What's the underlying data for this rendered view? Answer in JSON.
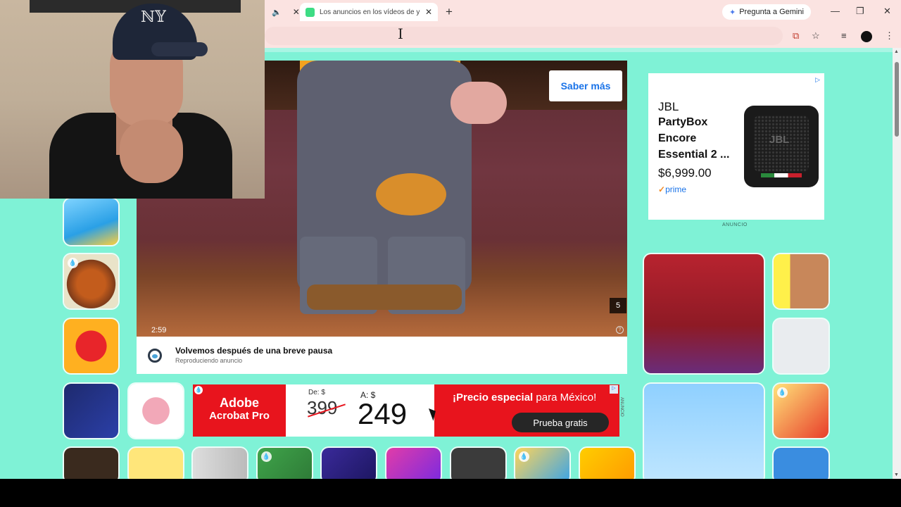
{
  "browser": {
    "tabs": [
      {
        "label": "Los anuncios en los vídeos de y",
        "active": true
      }
    ],
    "gemini_label": "Pregunta a Gemini",
    "new_tab_symbol": "+",
    "window_controls": {
      "minimize": "—",
      "maximize": "❐",
      "close": "✕"
    }
  },
  "video_ad": {
    "cta_label": "Saber más",
    "duration": "2:59",
    "skip_countdown": "5",
    "info_title": "Volvemos después de una breve pausa",
    "info_subtitle": "Reproduciendo anuncio"
  },
  "display_ad": {
    "brand": "JBL",
    "product": "PartyBox Encore Essential 2 ...",
    "price": "$6,999.00",
    "prime_label": "prime",
    "speaker_logo": "JBL",
    "ad_label": "ANUNCIO"
  },
  "banner_ad": {
    "brand_line1": "Adobe",
    "brand_line2": "Acrobat Pro",
    "from_label": "De: $",
    "old_price": "399",
    "to_label": "A: $",
    "new_price": "249",
    "promo_prefix": "¡Precio especial",
    "promo_suffix": " para México!",
    "cta_label": "Prueba gratis",
    "ad_label": "ANUNCIO"
  },
  "colors": {
    "page_background": "#7ff2d6",
    "browser_chrome": "#fbe3e1",
    "link_blue": "#1a73e8",
    "adobe_red": "#e8141d"
  },
  "icons": {
    "tab_audio": "speaker-icon",
    "gemini": "gemini-sparkle-icon",
    "install": "install-app-icon",
    "bookmark": "star-icon",
    "media": "media-controls-icon",
    "menu": "kebab-menu-icon"
  }
}
